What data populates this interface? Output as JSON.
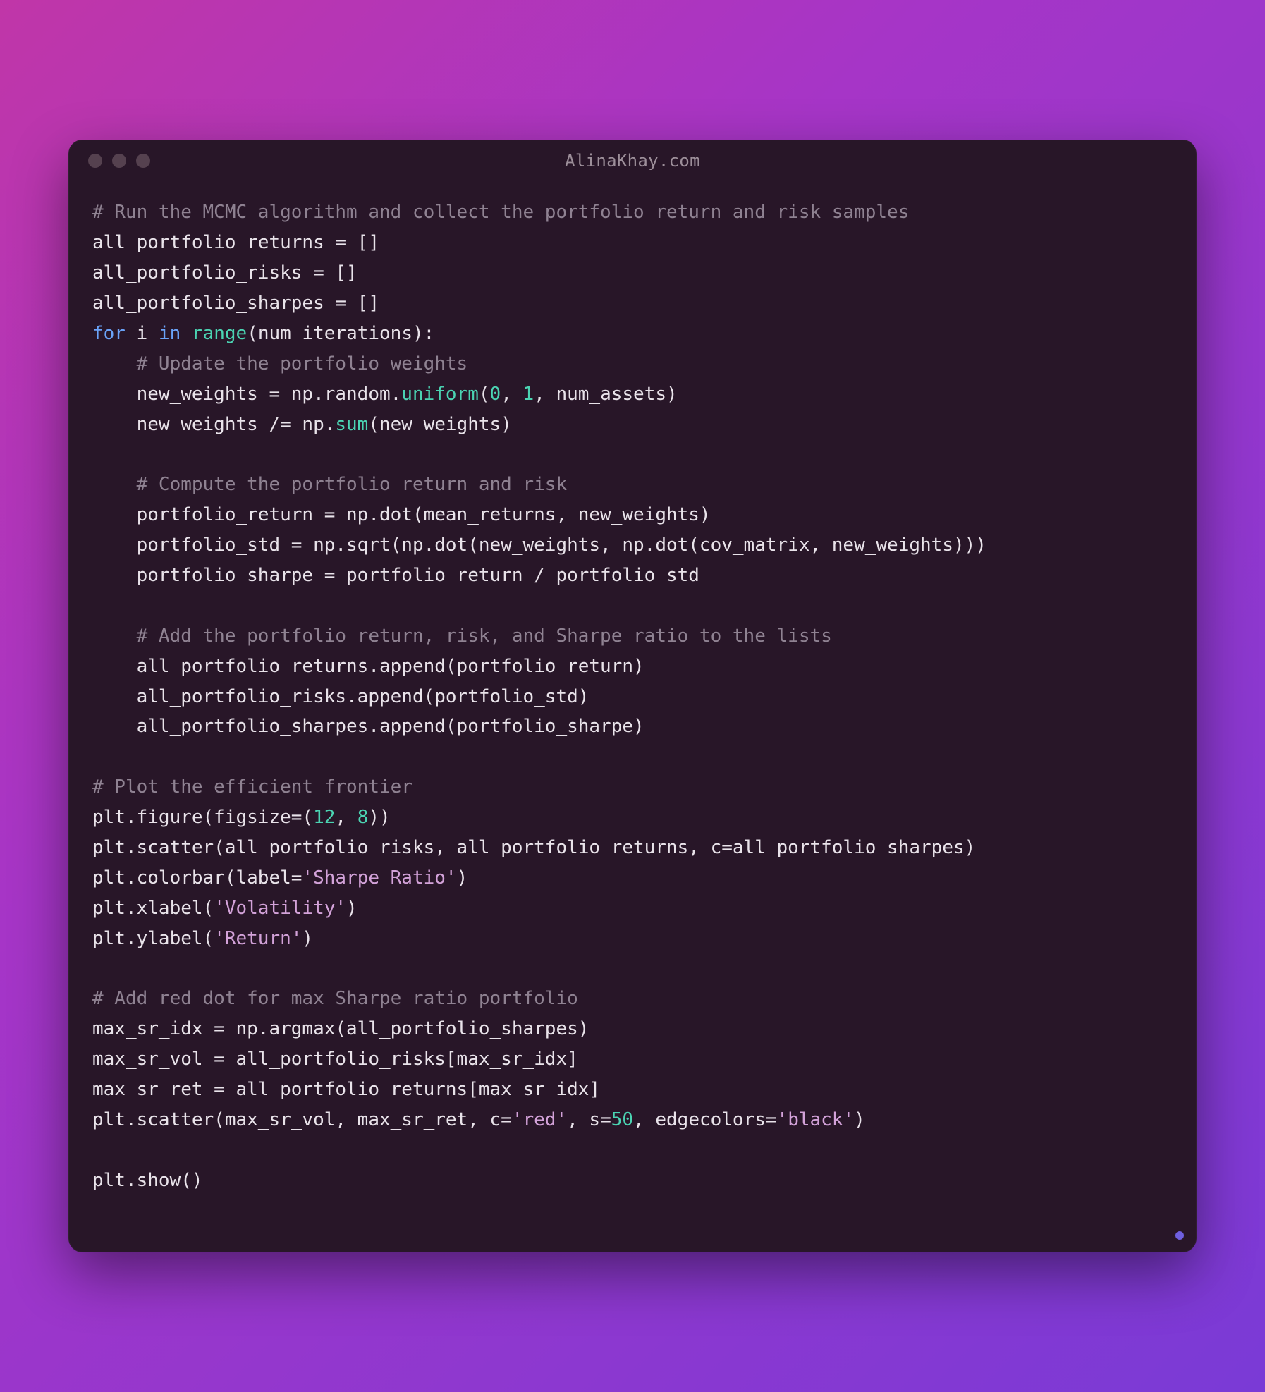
{
  "window": {
    "title": "AlinaKhay.com"
  },
  "code": {
    "l1": "# Run the MCMC algorithm and collect the portfolio return and risk samples",
    "l2a": "all_portfolio_returns = []",
    "l3a": "all_portfolio_risks = []",
    "l4a": "all_portfolio_sharpes = []",
    "for": "for",
    "in": "in",
    "i": " i ",
    "range": "range",
    "l5tail": "(num_iterations):",
    "l6": "    # Update the portfolio weights",
    "l7a": "    new_weights = np.random.",
    "uniform": "uniform",
    "l7b": "(",
    "zero": "0",
    "comma1": ", ",
    "one": "1",
    "l7c": ", num_assets)",
    "l8a": "    new_weights /= np.",
    "sum": "sum",
    "l8b": "(new_weights)",
    "blank": "",
    "l10": "    # Compute the portfolio return and risk",
    "l11": "    portfolio_return = np.dot(mean_returns, new_weights)",
    "l12": "    portfolio_std = np.sqrt(np.dot(new_weights, np.dot(cov_matrix, new_weights)))",
    "l13": "    portfolio_sharpe = portfolio_return / portfolio_std",
    "l15": "    # Add the portfolio return, risk, and Sharpe ratio to the lists",
    "l16": "    all_portfolio_returns.append(portfolio_return)",
    "l17": "    all_portfolio_risks.append(portfolio_std)",
    "l18": "    all_portfolio_sharpes.append(portfolio_sharpe)",
    "l20": "# Plot the efficient frontier",
    "l21a": "plt.figure(figsize=(",
    "twelve": "12",
    "comma2": ", ",
    "eight": "8",
    "l21b": "))",
    "l22": "plt.scatter(all_portfolio_risks, all_portfolio_returns, c=all_portfolio_sharpes)",
    "l23a": "plt.colorbar(label=",
    "sharpe": "'Sharpe Ratio'",
    "l23b": ")",
    "l24a": "plt.xlabel(",
    "vol": "'Volatility'",
    "l24b": ")",
    "l25a": "plt.ylabel(",
    "ret": "'Return'",
    "l25b": ")",
    "l27": "# Add red dot for max Sharpe ratio portfolio",
    "l28": "max_sr_idx = np.argmax(all_portfolio_sharpes)",
    "l29": "max_sr_vol = all_portfolio_risks[max_sr_idx]",
    "l30": "max_sr_ret = all_portfolio_returns[max_sr_idx]",
    "l31a": "plt.scatter(max_sr_vol, max_sr_ret, c=",
    "red": "'red'",
    "l31b": ", s=",
    "fifty": "50",
    "l31c": ", edgecolors=",
    "black": "'black'",
    "l31d": ")",
    "l33": "plt.show()"
  }
}
